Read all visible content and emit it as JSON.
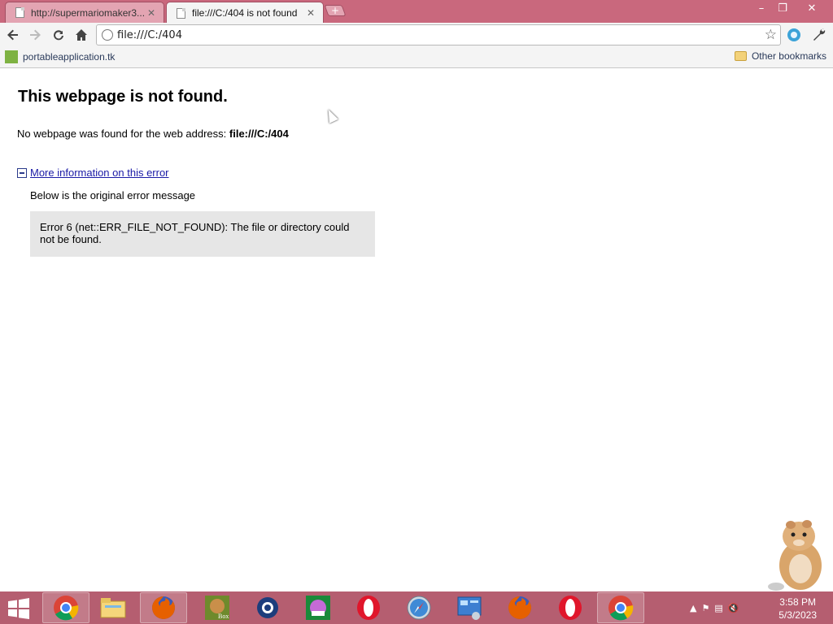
{
  "browser": {
    "tabs": [
      {
        "title": "http://supermariomaker3...",
        "active": false
      },
      {
        "title": "file:///C:/404 is not found",
        "active": true
      }
    ],
    "new_tab_label": "+",
    "window_controls": {
      "minimize": "–",
      "restore": "❐",
      "close": "✕"
    },
    "address": "file:///C:/404",
    "bookmarks": [
      {
        "label": "portableapplication.tk"
      }
    ],
    "other_bookmarks": "Other bookmarks"
  },
  "page": {
    "title": "This webpage is not found.",
    "description_prefix": "No webpage was found for the web address: ",
    "description_url": "file:///C:/404",
    "more_info_link": "More information on this error",
    "original_label": "Below is the original error message",
    "error_message": "Error 6 (net::ERR_FILE_NOT_FOUND): The file or directory could not be found."
  },
  "taskbar": {
    "apps": [
      {
        "name": "chrome-icon"
      },
      {
        "name": "file-explorer-icon"
      },
      {
        "name": "firefox-icon"
      },
      {
        "name": "box-app-icon"
      },
      {
        "name": "q-app-icon"
      },
      {
        "name": "paint-app-icon"
      },
      {
        "name": "opera-icon"
      },
      {
        "name": "safari-icon"
      },
      {
        "name": "control-panel-icon"
      },
      {
        "name": "firefox-icon"
      },
      {
        "name": "opera-icon"
      },
      {
        "name": "chrome-icon"
      }
    ],
    "time": "3:58 PM",
    "date": "5/3/2023"
  },
  "colors": {
    "titlebar": "#c9687d",
    "taskbar": "#b55e70",
    "link": "#1a1aa6"
  }
}
